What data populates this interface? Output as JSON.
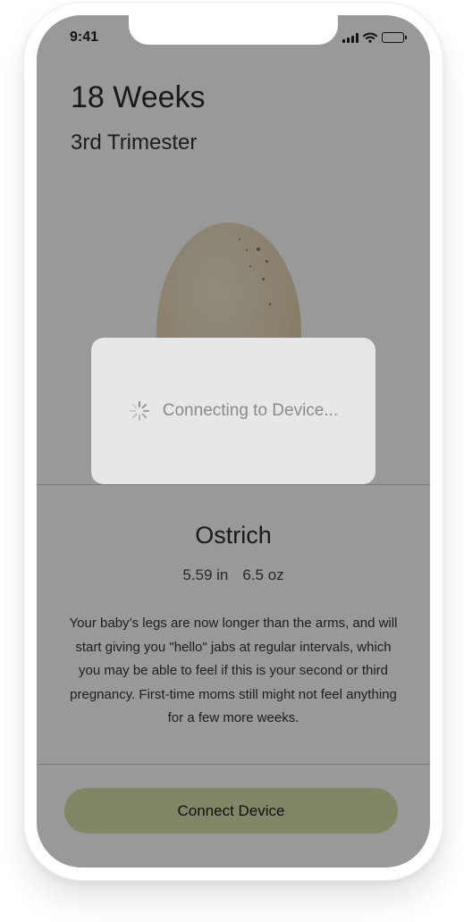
{
  "status_bar": {
    "time": "9:41",
    "icons": [
      "cellular-signal-icon",
      "wifi-icon",
      "battery-icon"
    ]
  },
  "header": {
    "week_title": "18 Weeks",
    "trimester": "3rd Trimester"
  },
  "illustration": {
    "icon": "ostrich-egg-image"
  },
  "size_comparison": {
    "name": "Ostrich",
    "length": "5.59 in",
    "weight": "6.5 oz"
  },
  "description": "Your baby’s legs are now longer than the arms, and will start giving you \"hello\" jabs at regular intervals, which you may be able to feel if this is your second or third pregnancy. First-time moms still might not feel anything for a few more weeks.",
  "footer": {
    "connect_button_label": "Connect Device"
  },
  "loading_overlay": {
    "message": "Connecting to Device...",
    "icon": "activity-spinner-icon"
  },
  "colors": {
    "button": "#d9dfaa",
    "overlay_dim": "rgba(0,0,0,0.40)",
    "hud_background": "#e7e7e7"
  }
}
